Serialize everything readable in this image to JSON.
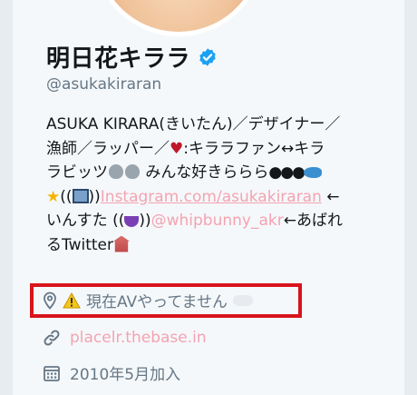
{
  "profile": {
    "name": "明日花キララ",
    "handle": "@asukakiraran",
    "bio": {
      "l1": "ASUKA KIRARA(きいたん)／デザイナー／",
      "l2a": "漁師／ラッパー／",
      "l2b": ":キララファン↔キラ",
      "l3a": "ラビッツ",
      "l3b": "みんな好きららら",
      "l4a": "((",
      "l4b": "))",
      "l4_link": "Instagram.com/asukakiraran",
      "l4c": " ←",
      "l5a": "いんすた ((",
      "l5b": "))",
      "l5_mention": "@whipbunny_akr",
      "l5c": "←あばれ",
      "l6": "るTwitter"
    },
    "location": "現在AVやってません",
    "website": "placelr.thebase.in",
    "joined": "2010年5月加入"
  },
  "colors": {
    "link": "#f4a3b1",
    "muted": "#657786",
    "highlight_border": "#d8141c",
    "verified": "#1da1f2"
  },
  "icons": [
    "verified-badge-icon",
    "location-pin-icon",
    "warning-icon",
    "link-icon",
    "calendar-icon"
  ]
}
